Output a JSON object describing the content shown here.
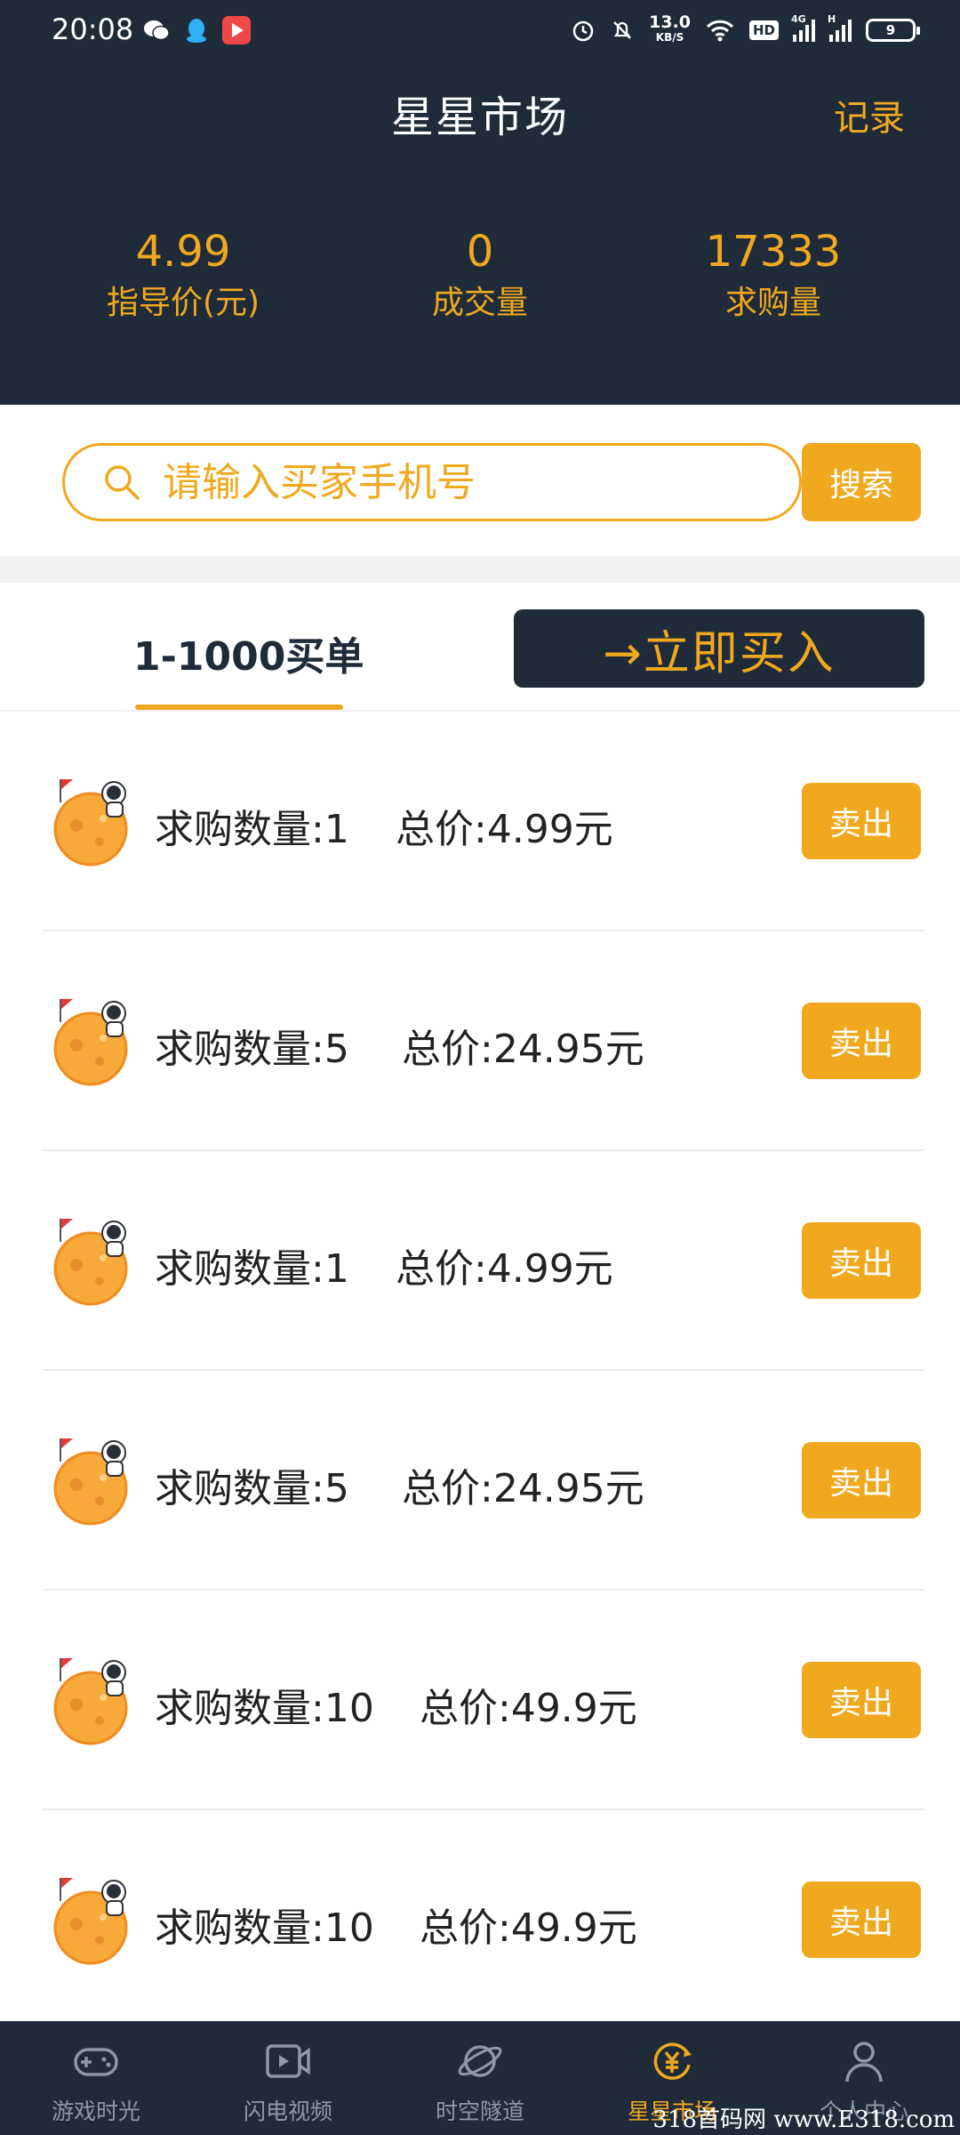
{
  "status_bar": {
    "time": "20:08",
    "speed_value": "13.0",
    "speed_unit": "KB/S",
    "hd_label": "HD",
    "net_4g": "4G",
    "net_h": "H",
    "battery": "9"
  },
  "header": {
    "title": "星星市场",
    "record_label": "记录"
  },
  "stats": [
    {
      "value": "4.99",
      "label": "指导价(元)"
    },
    {
      "value": "0",
      "label": "成交量"
    },
    {
      "value": "17333",
      "label": "求购量"
    }
  ],
  "search": {
    "placeholder": "请输入买家手机号",
    "button_label": "搜索"
  },
  "tab": {
    "label": "1-1000买单",
    "buy_button": "→立即买入"
  },
  "orders": [
    {
      "qty": "求购数量:1",
      "price": "总价:4.99元",
      "sell": "卖出"
    },
    {
      "qty": "求购数量:5",
      "price": "总价:24.95元",
      "sell": "卖出"
    },
    {
      "qty": "求购数量:1",
      "price": "总价:4.99元",
      "sell": "卖出"
    },
    {
      "qty": "求购数量:5",
      "price": "总价:24.95元",
      "sell": "卖出"
    },
    {
      "qty": "求购数量:10",
      "price": "总价:49.9元",
      "sell": "卖出"
    },
    {
      "qty": "求购数量:10",
      "price": "总价:49.9元",
      "sell": "卖出"
    }
  ],
  "bottom_nav": [
    {
      "label": "游戏时光",
      "icon": "gamepad-icon"
    },
    {
      "label": "闪电视频",
      "icon": "video-icon"
    },
    {
      "label": "时空隧道",
      "icon": "planet-icon"
    },
    {
      "label": "星星市场",
      "icon": "yuan-market-icon",
      "active": true
    },
    {
      "label": "个人中心",
      "icon": "person-icon"
    }
  ],
  "watermark": "318首码网 www.E318.com",
  "colors": {
    "accent": "#f0a91e",
    "dark": "#202b3a"
  }
}
